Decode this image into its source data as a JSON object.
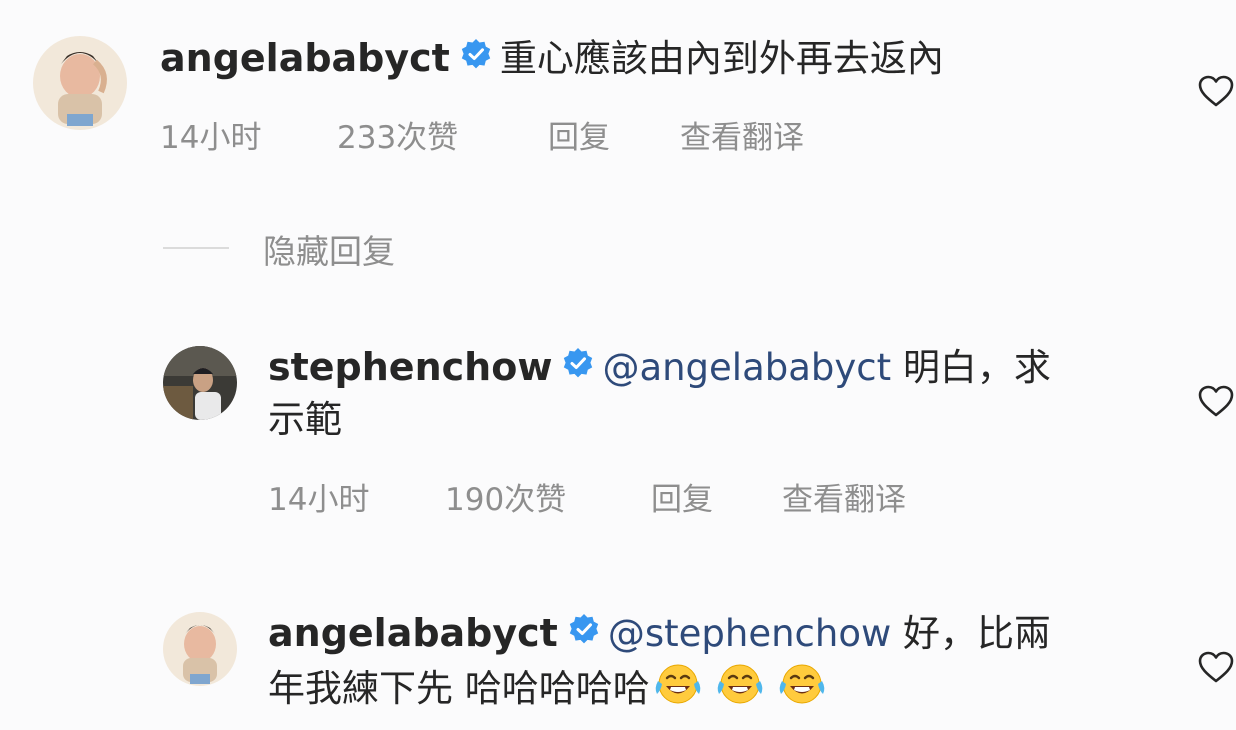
{
  "comments": [
    {
      "username": "angelababyct",
      "line1": "重心應該由內到外再去返內",
      "line2": "",
      "time": "14小时",
      "likes": "233次赞",
      "reply": "回复",
      "translate": "查看翻译"
    },
    {
      "username": "stephenchow",
      "mention": "@angelababyct",
      "line1": "明白，求",
      "line2": "示範",
      "time": "14小时",
      "likes": "190次赞",
      "reply": "回复",
      "translate": "查看翻译"
    },
    {
      "username": "angelababyct",
      "mention": "@stephenchow",
      "line1": "好，比兩",
      "line2": "年我練下先 哈哈哈哈哈"
    }
  ],
  "hide_replies_label": "隐藏回复",
  "icons": {
    "verified": "verified-badge-icon",
    "heart": "heart-outline-icon",
    "emoji": "face-with-tears-of-joy-icon"
  },
  "colors": {
    "verified_blue": "#3897f0",
    "meta_gray": "#8e8e8e",
    "mention_blue": "#2e4a7a"
  }
}
